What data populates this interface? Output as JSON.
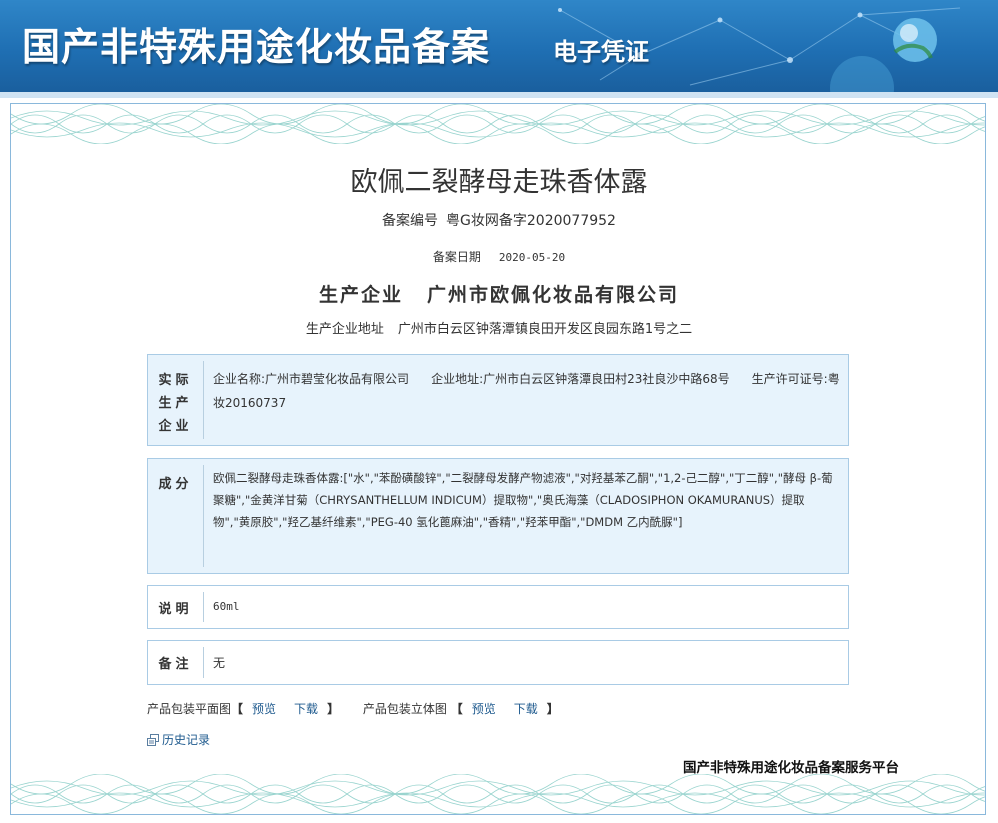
{
  "header": {
    "title": "国产非特殊用途化妆品备案",
    "subtitle": "电子凭证"
  },
  "certificate": {
    "product_name": "欧佩二裂酵母走珠香体露",
    "registration_label": "备案编号",
    "registration_number": "粤G妆网备字2020077952",
    "date_label": "备案日期",
    "date": "2020-05-20",
    "producer_label": "生产企业",
    "producer": "广州市欧佩化妆品有限公司",
    "producer_address_label": "生产企业地址",
    "producer_address": "广州市白云区钟落潭镇良田开发区良园东路1号之二"
  },
  "actual_producer": {
    "label": "实际\n生产\n企业",
    "name_label": "企业名称:",
    "name": "广州市碧莹化妆品有限公司",
    "address_label": "企业地址:",
    "address": "广州市白云区钟落潭良田村23社良沙中路68号",
    "license_label": "生产许可证号:",
    "license": "粤妆20160737"
  },
  "ingredients": {
    "label": "成分",
    "text": "欧佩二裂酵母走珠香体露:[\"水\",\"苯酚磺酸锌\",\"二裂酵母发酵产物滤液\",\"对羟基苯乙酮\",\"1,2-己二醇\",\"丁二醇\",\"酵母 β-葡聚糖\",\"金黄洋甘菊（CHRYSANTHELLUM INDICUM）提取物\",\"奥氏海藻（CLADOSIPHON OKAMURANUS）提取物\",\"黄原胶\",\"羟乙基纤维素\",\"PEG-40 氢化蓖麻油\",\"香精\",\"羟苯甲酯\",\"DMDM 乙内酰脲\"]"
  },
  "description": {
    "label": "说明",
    "value": "60ml"
  },
  "remarks": {
    "label": "备注",
    "value": "无"
  },
  "links": {
    "flat_label": "产品包装平面图",
    "flat_preview": "预览",
    "flat_download": "下载",
    "stereo_label": "产品包装立体图",
    "stereo_preview": "预览",
    "stereo_download": "下载",
    "bracket_open": "【",
    "bracket_close": "】"
  },
  "history": {
    "label": "历史记录",
    "icon": "history-icon"
  },
  "footer": {
    "platform": "国产非特殊用途化妆品备案服务平台"
  },
  "colors": {
    "banner": "#1f6fb3",
    "box_blue": "#e7f3fc",
    "box_border": "#a9cbe5",
    "link": "#1e5a8e",
    "wave": "#7fc9c2"
  }
}
